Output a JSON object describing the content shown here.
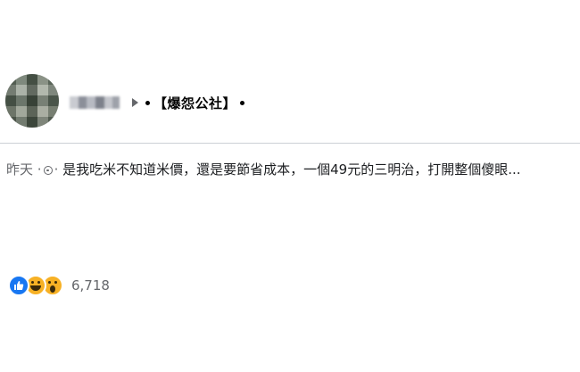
{
  "post": {
    "group_name": "【爆怨公社】",
    "timestamp": "昨天",
    "separator": "·",
    "audience_icon": "globe-icon",
    "text": "是我吃米不知道米價，還是要節省成本，一個49元的三明治，打開整個傻眼..."
  },
  "reactions": {
    "types": [
      "like-icon",
      "haha-icon",
      "wow-icon"
    ],
    "count": "6,718"
  },
  "colors": {
    "like": "#1877f2",
    "haha_wow": "#f7b125",
    "meta_text": "#65676b"
  }
}
